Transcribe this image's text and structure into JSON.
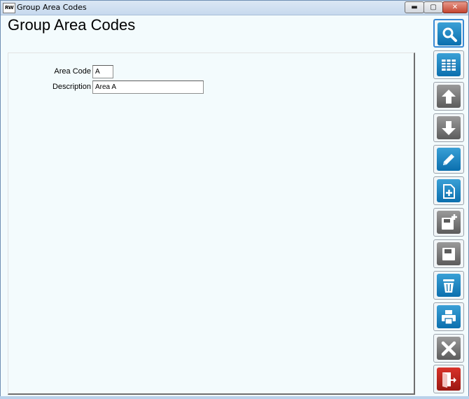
{
  "window": {
    "title": "Group Area Codes",
    "app_icon_label": "RW",
    "minimize_glyph": "▬",
    "maximize_glyph": "▢",
    "close_glyph": "✕"
  },
  "page": {
    "heading": "Group Area Codes"
  },
  "form": {
    "area_code_label": "Area Code",
    "area_code_value": "A",
    "description_label": "Description",
    "description_value": "Area A"
  },
  "toolbar": [
    {
      "name": "search",
      "icon": "search-icon",
      "color": "blue"
    },
    {
      "name": "grid-view",
      "icon": "grid-icon",
      "color": "blue"
    },
    {
      "name": "previous-record",
      "icon": "arrow-up-icon",
      "color": "grey"
    },
    {
      "name": "next-record",
      "icon": "arrow-down-icon",
      "color": "grey"
    },
    {
      "name": "edit",
      "icon": "pencil-icon",
      "color": "blue"
    },
    {
      "name": "new-record",
      "icon": "new-document-icon",
      "color": "blue"
    },
    {
      "name": "save-new",
      "icon": "save-plus-icon",
      "color": "grey"
    },
    {
      "name": "save",
      "icon": "floppy-disk-icon",
      "color": "grey"
    },
    {
      "name": "delete",
      "icon": "trash-icon",
      "color": "blue"
    },
    {
      "name": "print",
      "icon": "printer-icon",
      "color": "blue"
    },
    {
      "name": "cancel",
      "icon": "x-icon",
      "color": "grey"
    },
    {
      "name": "exit",
      "icon": "exit-door-icon",
      "color": "red"
    }
  ],
  "colors": {
    "blue_button": "#0b6fae",
    "grey_button": "#5c5c5c",
    "red_button": "#b01c14",
    "background": "#f3fbfd"
  }
}
